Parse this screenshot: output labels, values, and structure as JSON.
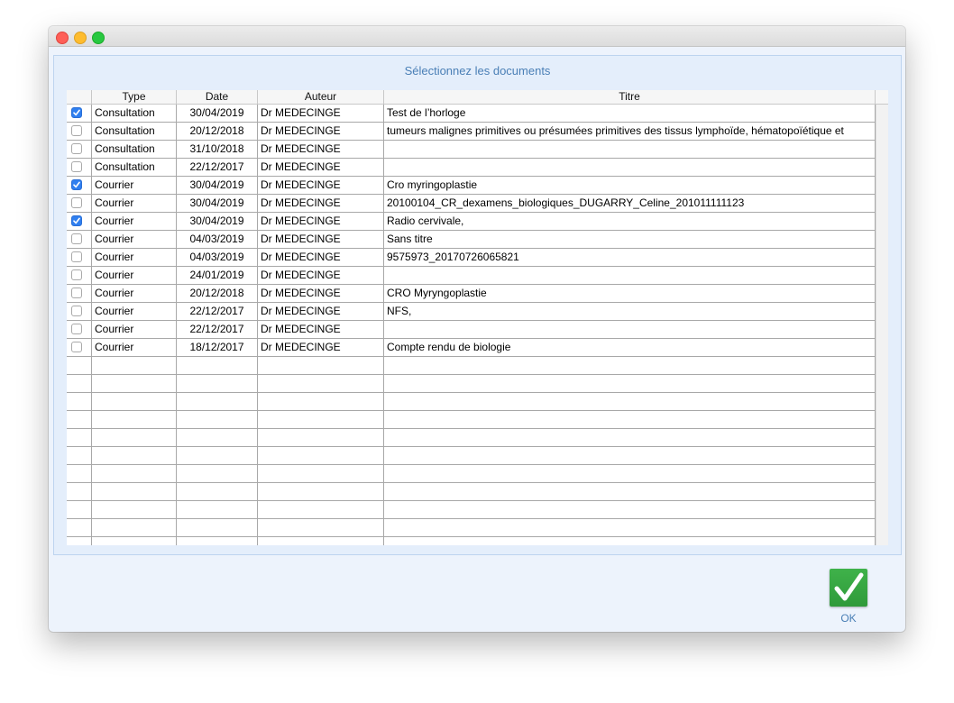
{
  "dialog": {
    "title": "Sélectionnez les documents",
    "ok_label": "OK"
  },
  "table": {
    "columns": [
      "",
      "Type",
      "Date",
      "Auteur",
      "Titre"
    ],
    "rows": [
      {
        "checked": true,
        "type": "Consultation",
        "date": "30/04/2019",
        "author": "Dr MEDECINGE",
        "title": "Test de l’horloge"
      },
      {
        "checked": false,
        "type": "Consultation",
        "date": "20/12/2018",
        "author": "Dr MEDECINGE",
        "title": "tumeurs malignes primitives ou présumées primitives des tissus lymphoïde, hématopoïétique et"
      },
      {
        "checked": false,
        "type": "Consultation",
        "date": "31/10/2018",
        "author": "Dr MEDECINGE",
        "title": ""
      },
      {
        "checked": false,
        "type": "Consultation",
        "date": "22/12/2017",
        "author": "Dr MEDECINGE",
        "title": ""
      },
      {
        "checked": true,
        "type": "Courrier",
        "date": "30/04/2019",
        "author": "Dr MEDECINGE",
        "title": "Cro myringoplastie"
      },
      {
        "checked": false,
        "type": "Courrier",
        "date": "30/04/2019",
        "author": "Dr MEDECINGE",
        "title": "20100104_CR_dexamens_biologiques_DUGARRY_Celine_201011111123"
      },
      {
        "checked": true,
        "type": "Courrier",
        "date": "30/04/2019",
        "author": "Dr MEDECINGE",
        "title": "Radio cervivale,"
      },
      {
        "checked": false,
        "type": "Courrier",
        "date": "04/03/2019",
        "author": "Dr MEDECINGE",
        "title": "Sans titre"
      },
      {
        "checked": false,
        "type": "Courrier",
        "date": "04/03/2019",
        "author": "Dr MEDECINGE",
        "title": "9575973_20170726065821"
      },
      {
        "checked": false,
        "type": "Courrier",
        "date": "24/01/2019",
        "author": "Dr MEDECINGE",
        "title": ""
      },
      {
        "checked": false,
        "type": "Courrier",
        "date": "20/12/2018",
        "author": "Dr MEDECINGE",
        "title": "CRO Myryngoplastie"
      },
      {
        "checked": false,
        "type": "Courrier",
        "date": "22/12/2017",
        "author": "Dr MEDECINGE",
        "title": "NFS,"
      },
      {
        "checked": false,
        "type": "Courrier",
        "date": "22/12/2017",
        "author": "Dr MEDECINGE",
        "title": ""
      },
      {
        "checked": false,
        "type": "Courrier",
        "date": "18/12/2017",
        "author": "Dr MEDECINGE",
        "title": "Compte rendu de biologie"
      }
    ],
    "empty_rows": 11
  },
  "colors": {
    "accent": "#2f7ff0",
    "title_text": "#4a7fb6",
    "ok_green": "#3fb24a"
  },
  "icons": {
    "ok": "checkmark-icon",
    "checkbox_checked": "check-icon"
  }
}
